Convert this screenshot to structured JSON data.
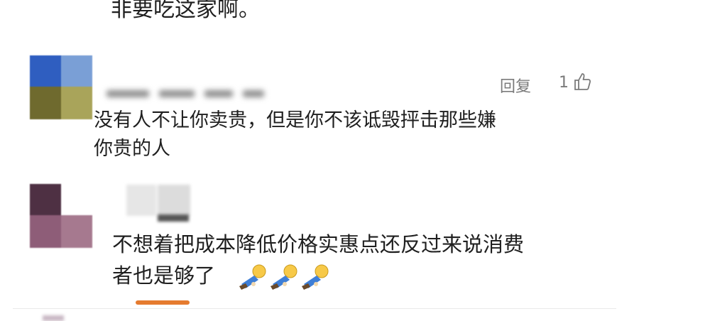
{
  "previous_comment": {
    "text_tail": "非要吃这家啊。"
  },
  "comment1": {
    "avatar_colors": [
      "#2f5ec0",
      "#7a9fd6",
      "#6f6a2e",
      "#a9a45a"
    ],
    "reply_label": "回复",
    "like_count": "1",
    "like_icon": "thumbs-up-icon",
    "text_line1": "没有人不让你卖贵，但是你不该诋毁抨击那些嫌",
    "text_line2": "你贵的人"
  },
  "comment2": {
    "avatar_colors": [
      "#4e3043",
      "#ffffff",
      "#8e5d78",
      "#a6798f"
    ],
    "text_line1": "不想着把成本降低价格实惠点还反过来说消费",
    "text_line2": "者也是够了",
    "emoji_icon": "kowtow-emoji-icon",
    "emoji_count": 3
  },
  "colors": {
    "accent_underline": "#e57b2f",
    "meta_text": "#7b7b7b",
    "body_text": "#1f1f1f"
  }
}
